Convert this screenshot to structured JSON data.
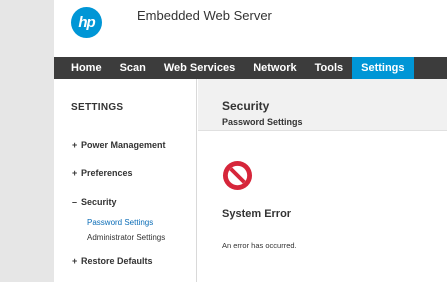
{
  "header": {
    "logo_text": "hp",
    "app_title": "Embedded Web Server"
  },
  "nav": {
    "tabs": [
      {
        "label": "Home"
      },
      {
        "label": "Scan"
      },
      {
        "label": "Web Services"
      },
      {
        "label": "Network"
      },
      {
        "label": "Tools"
      },
      {
        "label": "Settings",
        "active": true
      }
    ]
  },
  "sidebar": {
    "title": "SETTINGS",
    "items": [
      {
        "mark": "+",
        "label": "Power Management"
      },
      {
        "mark": "+",
        "label": "Preferences"
      },
      {
        "mark": "–",
        "label": "Security",
        "expanded": true
      },
      {
        "mark": "+",
        "label": "Restore Defaults"
      }
    ],
    "security_subitems": [
      {
        "label": "Password Settings",
        "active": true
      },
      {
        "label": "Administrator Settings"
      }
    ]
  },
  "main": {
    "title": "Security",
    "subtitle": "Password Settings",
    "error_icon": "no-entry-icon",
    "error_title": "System Error",
    "error_message": "An error has occurred."
  },
  "colors": {
    "brand_blue": "#0096d6",
    "nav_background": "#3c3c3c",
    "error_red": "#d6263a",
    "active_link": "#0b6db7"
  }
}
